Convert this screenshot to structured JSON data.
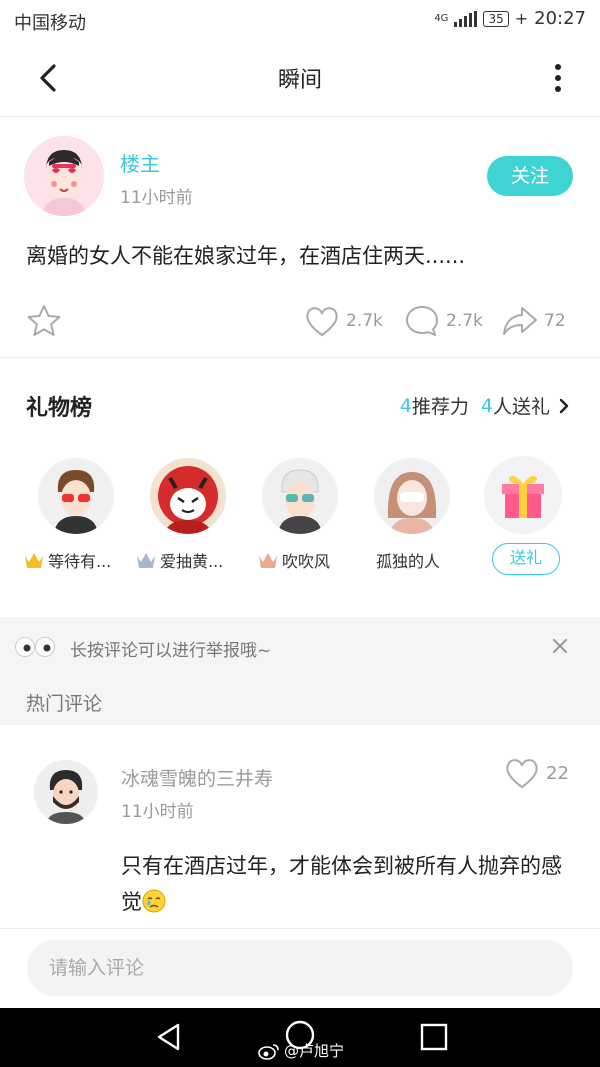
{
  "status_bar": {
    "carrier": "中国移动",
    "network": "4G",
    "battery": "35",
    "time": "20:27"
  },
  "header": {
    "title": "瞬间",
    "back_icon": "chevron-left-icon",
    "more_icon": "vertical-dots-icon"
  },
  "post": {
    "author": "楼主",
    "time": "11小时前",
    "follow_label": "关注",
    "text": "离婚的女人不能在娘家过年，在酒店住两天......",
    "likes": "2.7k",
    "comments": "2.7k",
    "shares": "72"
  },
  "gift_board": {
    "title": "礼物榜",
    "recommend_count": "4",
    "recommend_label": "推荐力",
    "giver_count": "4",
    "giver_label": "人送礼",
    "givers": [
      {
        "name": "等待有...",
        "rank": "1"
      },
      {
        "name": "爱抽黄...",
        "rank": "2"
      },
      {
        "name": "吹吹风",
        "rank": "3"
      },
      {
        "name": "孤独的人",
        "rank": ""
      }
    ],
    "send_label": "送礼"
  },
  "tip": {
    "text": "长按评论可以进行举报哦~"
  },
  "hot_comments": {
    "title": "热门评论",
    "items": [
      {
        "name": "冰魂雪魄的三井寿",
        "time": "11小时前",
        "likes": "22",
        "text": "只有在酒店过年，才能体会到被所有人抛弃的感觉"
      }
    ]
  },
  "comment_input": {
    "placeholder": "请输入评论"
  },
  "watermark": {
    "text": "@卢旭宁"
  },
  "colors": {
    "accent": "#3bc8d8",
    "follow_bg": "#3fd3d3",
    "band_bg": "#f5f5f7"
  }
}
